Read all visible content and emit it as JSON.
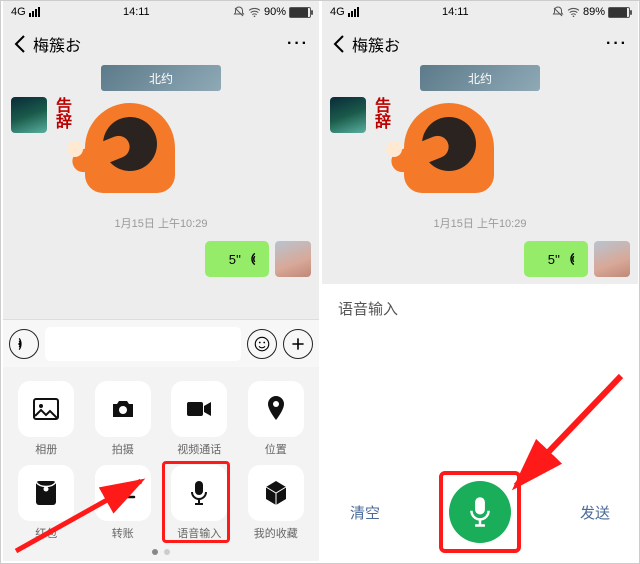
{
  "left": {
    "status": {
      "net": "4G",
      "time": "14:11",
      "batt_pct": "90%",
      "batt_fill": 90
    },
    "header": {
      "title": "梅簇お"
    },
    "chat": {
      "top_thumb": "北约",
      "msg_text": "告辞",
      "timestamp": "1月15日 上午10:29",
      "voice_len": "5''"
    },
    "attachments": [
      {
        "label": "相册",
        "icon": "image"
      },
      {
        "label": "拍摄",
        "icon": "camera"
      },
      {
        "label": "视频通话",
        "icon": "video"
      },
      {
        "label": "位置",
        "icon": "pin"
      },
      {
        "label": "红包",
        "icon": "packet"
      },
      {
        "label": "转账",
        "icon": "transfer"
      },
      {
        "label": "语音输入",
        "icon": "mic"
      },
      {
        "label": "我的收藏",
        "icon": "cube"
      }
    ]
  },
  "right": {
    "status": {
      "net": "4G",
      "time": "14:11",
      "batt_pct": "89%",
      "batt_fill": 89
    },
    "header": {
      "title": "梅簇お"
    },
    "chat": {
      "top_thumb": "北约",
      "msg_text": "告辞",
      "timestamp": "1月15日 上午10:29",
      "voice_len": "5''"
    },
    "voice_panel": {
      "title": "语音输入",
      "clear": "清空",
      "send": "发送"
    }
  }
}
